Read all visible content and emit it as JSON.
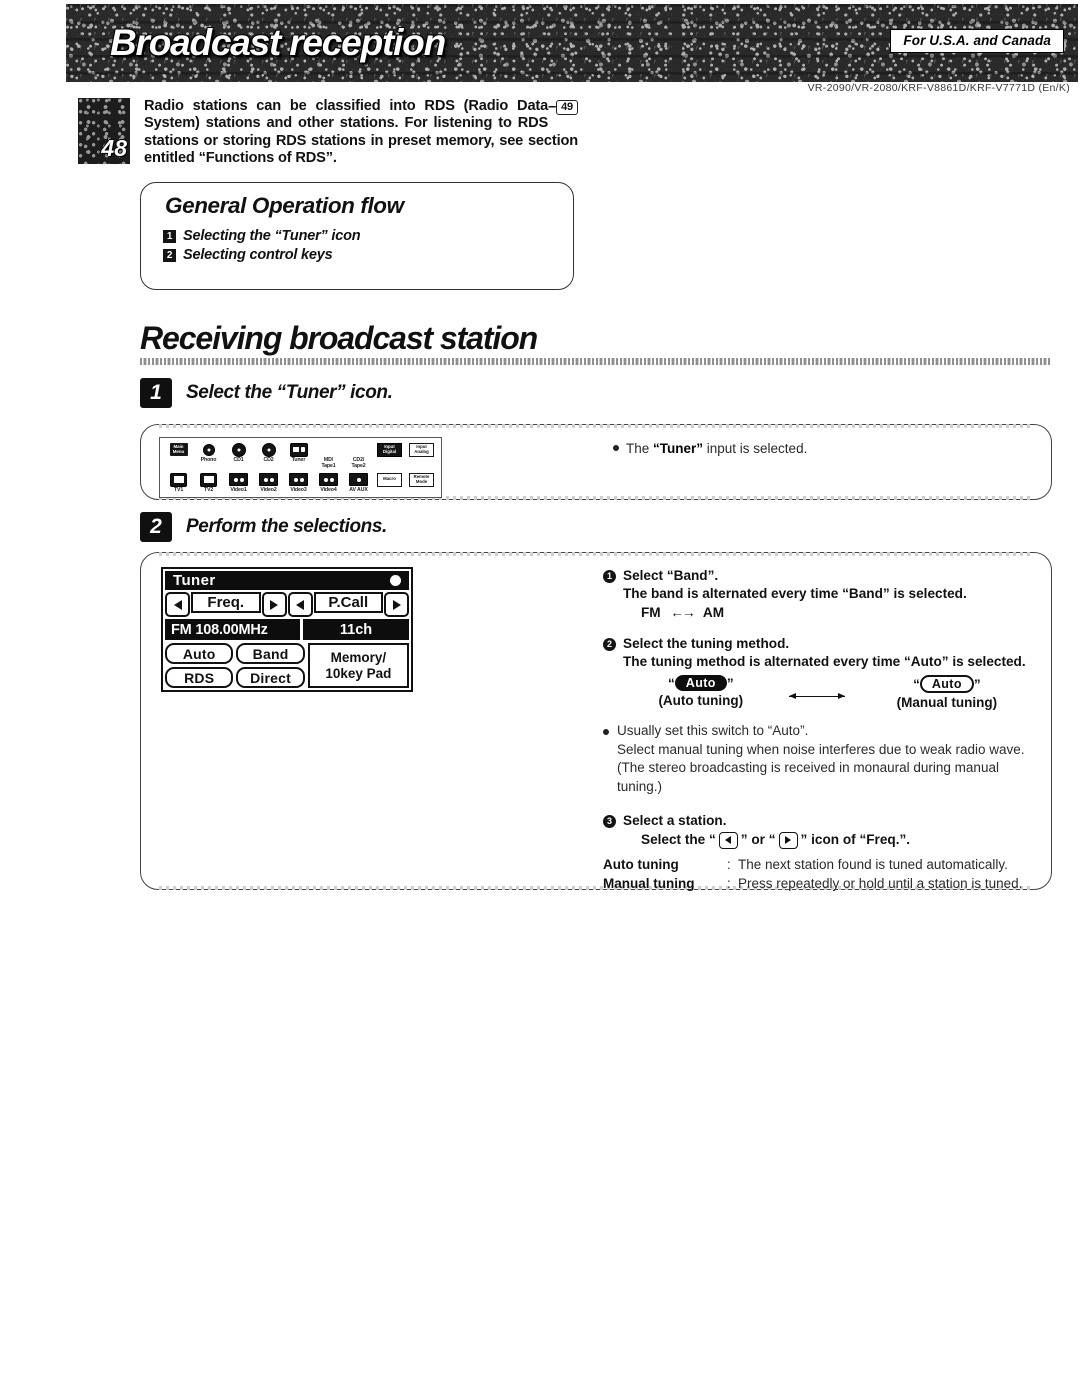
{
  "header": {
    "title": "Broadcast reception",
    "region_badge": "For U.S.A. and Canada",
    "model_line": "VR-2090/VR-2080/KRF-V8861D/KRF-V7771D (En/K)"
  },
  "intro": {
    "page_number": "48",
    "text": "Radio stations can be classified into RDS (Radio Data System) stations and other stations. For listening to RDS stations or storing RDS stations in preset memory, see section entitled “Functions of RDS”.",
    "ref_dash": "–",
    "ref_page": "49"
  },
  "flow": {
    "title": "General Operation flow",
    "items": [
      {
        "num": "1",
        "label": "Selecting the “Tuner” icon"
      },
      {
        "num": "2",
        "label": "Selecting control keys"
      }
    ]
  },
  "section": {
    "title": "Receiving broadcast station"
  },
  "step1": {
    "badge": "1",
    "title": "Select the “Tuner” icon.",
    "note_bullet": "●",
    "note_pre": "The ",
    "note_bold": "“Tuner”",
    "note_post": " input is selected.",
    "remote": {
      "row1": [
        {
          "label": "",
          "glyph": "main-menu",
          "glyph_text": "Main\nMenu"
        },
        {
          "label": "Phono",
          "glyph": "circle-dot"
        },
        {
          "label": "CD1",
          "glyph": "disc"
        },
        {
          "label": "CD2",
          "glyph": "disc"
        },
        {
          "label": "Tuner",
          "glyph": "tuner"
        },
        {
          "label": "MD/\nTape1",
          "glyph": "none"
        },
        {
          "label": "CD2/\nTape2",
          "glyph": "none"
        },
        {
          "label": "",
          "glyph": "wide-inv",
          "glyph_text": "Input\nDigital"
        },
        {
          "label": "",
          "glyph": "wide",
          "glyph_text": "Input\nAnalog"
        }
      ],
      "row2": [
        {
          "label": "TV1",
          "glyph": "tv"
        },
        {
          "label": "TV2",
          "glyph": "tv"
        },
        {
          "label": "Video1",
          "glyph": "cassette"
        },
        {
          "label": "Video2",
          "glyph": "cassette"
        },
        {
          "label": "Video3",
          "glyph": "cassette"
        },
        {
          "label": "Video4",
          "glyph": "cassette"
        },
        {
          "label": "AV AUX",
          "glyph": "cassette"
        },
        {
          "label": "",
          "glyph": "wide",
          "glyph_text": "Macro"
        },
        {
          "label": "",
          "glyph": "wide",
          "glyph_text": "Remote\nMode"
        }
      ]
    }
  },
  "step2": {
    "badge": "2",
    "title": "Perform the selections.",
    "tuner": {
      "title": "Tuner",
      "freq_label": "Freq.",
      "pcall_label": "P.Call",
      "frequency": "FM 108.00MHz",
      "channel": "11ch",
      "keys": [
        "Auto",
        "Band",
        "RDS",
        "Direct"
      ],
      "memory_line1": "Memory/",
      "memory_line2": "10key Pad"
    },
    "instructions": [
      {
        "num": "1",
        "head": "Select “Band”.",
        "body": "The band is alternated every time “Band” is selected.",
        "sub_left": "FM",
        "sub_right": "AM"
      },
      {
        "num": "2",
        "head": "Select the tuning method.",
        "body": "The tuning method is alternated every time “Auto” is selected.",
        "state_a_chip": "Auto",
        "state_a_caption": "(Auto tuning)",
        "state_b_chip": "Auto",
        "state_b_caption": "(Manual tuning)",
        "bullet": "Usually set this switch to “Auto”.",
        "bullet_body": "Select manual tuning when noise interferes due to weak radio wave. (The stereo broadcasting is received in monaural during manual tuning.)"
      },
      {
        "num": "3",
        "head": "Select a station.",
        "icon_line_pre": "Select the “",
        "icon_line_mid": "” or “",
        "icon_line_post": "” icon of “Freq.”.",
        "rows": [
          {
            "key": "Auto tuning",
            "sep": ":",
            "value": "The next station found is tuned automatically."
          },
          {
            "key": "Manual tuning",
            "sep": ":",
            "value": "Press repeatedly or hold until a station is tuned."
          }
        ]
      }
    ]
  }
}
